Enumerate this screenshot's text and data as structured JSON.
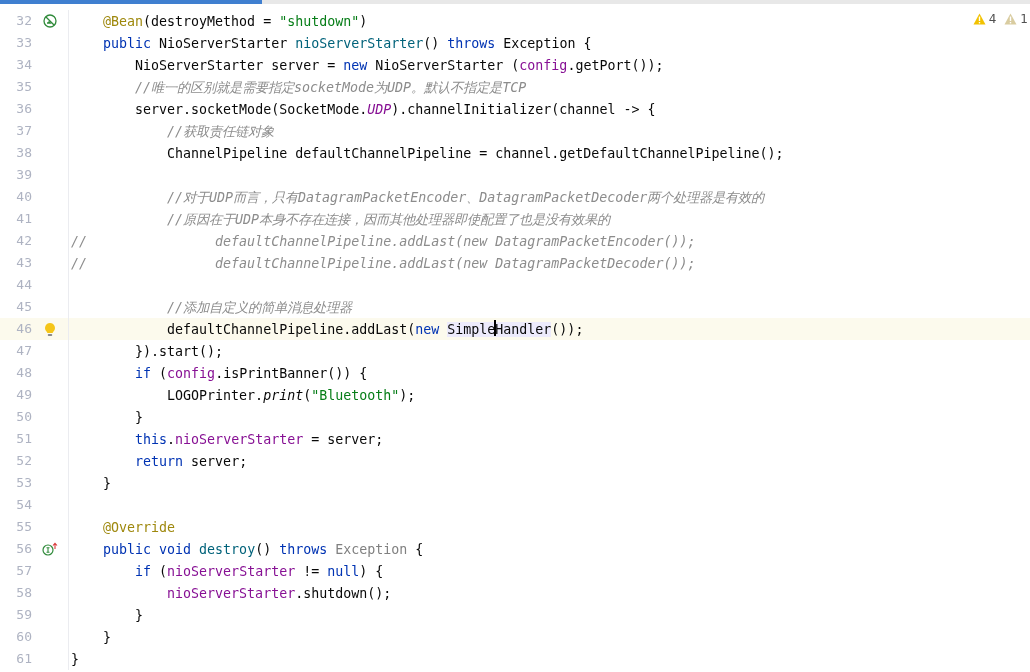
{
  "inspections": [
    {
      "kind": "warning",
      "count": "4"
    },
    {
      "kind": "weak_warning",
      "count": "1"
    }
  ],
  "lines": [
    {
      "number": "32",
      "kind": "code",
      "current": false,
      "gutter_icon": {
        "kind": "bean"
      },
      "tokens": [
        {
          "kind": "annotation",
          "text": "@Bean"
        },
        {
          "kind": "plain",
          "text": "(destroyMethod = "
        },
        {
          "kind": "string",
          "text": "\"shutdown\""
        },
        {
          "kind": "plain",
          "text": ")"
        }
      ]
    },
    {
      "number": "33",
      "kind": "code",
      "current": false,
      "tokens": [
        {
          "kind": "keyword",
          "text": "public"
        },
        {
          "kind": "plain",
          "text": " NioServerStarter "
        },
        {
          "kind": "method",
          "text": "nioServerStarter"
        },
        {
          "kind": "plain",
          "text": "() "
        },
        {
          "kind": "keyword",
          "text": "throws"
        },
        {
          "kind": "plain",
          "text": " Exception {"
        }
      ],
      "children": [
        {
          "number": "34",
          "kind": "code",
          "current": false,
          "tokens": [
            {
              "kind": "plain",
              "text": "NioServerStarter server = "
            },
            {
              "kind": "keyword",
              "text": "new"
            },
            {
              "kind": "plain",
              "text": " NioServerStarter ("
            },
            {
              "kind": "field",
              "text": "config"
            },
            {
              "kind": "plain",
              "text": ".getPort());"
            }
          ]
        },
        {
          "number": "35",
          "kind": "code",
          "current": false,
          "tokens": [
            {
              "kind": "comment",
              "text": "//唯一的区别就是需要指定socketMode为UDP。默认不指定是TCP"
            }
          ]
        },
        {
          "number": "36",
          "kind": "code",
          "current": false,
          "tokens": [
            {
              "kind": "plain",
              "text": "server.socketMode(SocketMode."
            },
            {
              "kind": "constant",
              "text": "UDP"
            },
            {
              "kind": "plain",
              "text": ").channelInitializer(channel -> {"
            }
          ],
          "children": [
            {
              "number": "37",
              "kind": "code",
              "current": false,
              "tokens": [
                {
                  "kind": "comment",
                  "text": "//获取责任链对象"
                }
              ]
            },
            {
              "number": "38",
              "kind": "code",
              "current": false,
              "tokens": [
                {
                  "kind": "plain",
                  "text": "ChannelPipeline defaultChannelPipeline = channel.getDefaultChannelPipeline();"
                }
              ]
            },
            {
              "number": "39",
              "kind": "code",
              "current": false
            },
            {
              "number": "40",
              "kind": "code",
              "current": false,
              "tokens": [
                {
                  "kind": "comment",
                  "text": "//对于UDP而言，只有DatagramPacketEncoder、DatagramPacketDecoder两个处理器是有效的"
                }
              ]
            },
            {
              "number": "41",
              "kind": "code",
              "current": false,
              "tokens": [
                {
                  "kind": "comment",
                  "text": "//原因在于UDP本身不存在连接，因而其他处理器即使配置了也是没有效果的"
                }
              ]
            },
            {
              "number": "42",
              "kind": "flush",
              "current": false,
              "tokens": [
                {
                  "kind": "comment",
                  "text": "//                defaultChannelPipeline.addLast(new DatagramPacketEncoder());"
                }
              ]
            },
            {
              "number": "43",
              "kind": "flush",
              "current": false,
              "tokens": [
                {
                  "kind": "comment",
                  "text": "//                defaultChannelPipeline.addLast(new DatagramPacketDecoder());"
                }
              ]
            },
            {
              "number": "44",
              "kind": "code",
              "current": false
            },
            {
              "number": "45",
              "kind": "code",
              "current": false,
              "tokens": [
                {
                  "kind": "comment",
                  "text": "//添加自定义的简单消息处理器"
                }
              ]
            },
            {
              "number": "46",
              "kind": "code",
              "current": true,
              "gutter_icon": {
                "kind": "bulb"
              },
              "tokens": [
                {
                  "kind": "plain",
                  "text": "defaultChannelPipeline.addLast("
                },
                {
                  "kind": "keyword",
                  "text": "new "
                },
                {
                  "kind": "usage",
                  "text": "Simple",
                  "caret": true
                },
                {
                  "kind": "usage",
                  "text": "Handler"
                },
                {
                  "kind": "plain",
                  "text": "());"
                }
              ]
            }
          ]
        },
        {
          "number": "47",
          "kind": "code",
          "current": false,
          "tokens": [
            {
              "kind": "plain",
              "text": "}).start();"
            }
          ]
        },
        {
          "number": "48",
          "kind": "code",
          "current": false,
          "tokens": [
            {
              "kind": "keyword",
              "text": "if"
            },
            {
              "kind": "plain",
              "text": " ("
            },
            {
              "kind": "field",
              "text": "config"
            },
            {
              "kind": "plain",
              "text": ".isPrintBanner()) {"
            }
          ],
          "children": [
            {
              "number": "49",
              "kind": "code",
              "current": false,
              "tokens": [
                {
                  "kind": "plain",
                  "text": "LOGOPrinter."
                },
                {
                  "kind": "static_method",
                  "text": "print"
                },
                {
                  "kind": "plain",
                  "text": "("
                },
                {
                  "kind": "string",
                  "text": "\"Bluetooth\""
                },
                {
                  "kind": "plain",
                  "text": ");"
                }
              ]
            }
          ]
        },
        {
          "number": "50",
          "kind": "code",
          "current": false,
          "tokens": [
            {
              "kind": "plain",
              "text": "}"
            }
          ]
        },
        {
          "number": "51",
          "kind": "code",
          "current": false,
          "tokens": [
            {
              "kind": "keyword",
              "text": "this"
            },
            {
              "kind": "plain",
              "text": "."
            },
            {
              "kind": "field",
              "text": "nioServerStarter"
            },
            {
              "kind": "plain",
              "text": " = server;"
            }
          ]
        },
        {
          "number": "52",
          "kind": "code",
          "current": false,
          "tokens": [
            {
              "kind": "keyword",
              "text": "return"
            },
            {
              "kind": "plain",
              "text": " server;"
            }
          ]
        }
      ]
    },
    {
      "number": "53",
      "kind": "code",
      "current": false,
      "tokens": [
        {
          "kind": "plain",
          "text": "}"
        }
      ]
    },
    {
      "number": "54",
      "kind": "code",
      "current": false
    },
    {
      "number": "55",
      "kind": "code",
      "current": false,
      "tokens": [
        {
          "kind": "annotation",
          "text": "@Override"
        }
      ]
    },
    {
      "number": "56",
      "kind": "code",
      "current": false,
      "gutter_icon": {
        "kind": "implements"
      },
      "tokens": [
        {
          "kind": "keyword",
          "text": "public void "
        },
        {
          "kind": "method",
          "text": "destroy"
        },
        {
          "kind": "plain",
          "text": "() "
        },
        {
          "kind": "keyword",
          "text": "throws "
        },
        {
          "kind": "unused",
          "text": "Exception"
        },
        {
          "kind": "plain",
          "text": " {"
        }
      ],
      "children": [
        {
          "number": "57",
          "kind": "code",
          "current": false,
          "tokens": [
            {
              "kind": "keyword",
              "text": "if"
            },
            {
              "kind": "plain",
              "text": " ("
            },
            {
              "kind": "field",
              "text": "nioServerStarter"
            },
            {
              "kind": "plain",
              "text": " != "
            },
            {
              "kind": "keyword",
              "text": "null"
            },
            {
              "kind": "plain",
              "text": ") {"
            }
          ],
          "children": [
            {
              "number": "58",
              "kind": "code",
              "current": false,
              "tokens": [
                {
                  "kind": "field",
                  "text": "nioServerStarter"
                },
                {
                  "kind": "plain",
                  "text": ".shutdown();"
                }
              ]
            }
          ]
        },
        {
          "number": "59",
          "kind": "code",
          "current": false,
          "tokens": [
            {
              "kind": "plain",
              "text": "}"
            }
          ]
        }
      ]
    },
    {
      "number": "60",
      "kind": "code",
      "current": false,
      "tokens": [
        {
          "kind": "plain",
          "text": "}"
        }
      ]
    },
    {
      "number": "61",
      "kind": "flush",
      "current": false,
      "tokens": [
        {
          "kind": "plain",
          "text": "}"
        }
      ]
    }
  ]
}
